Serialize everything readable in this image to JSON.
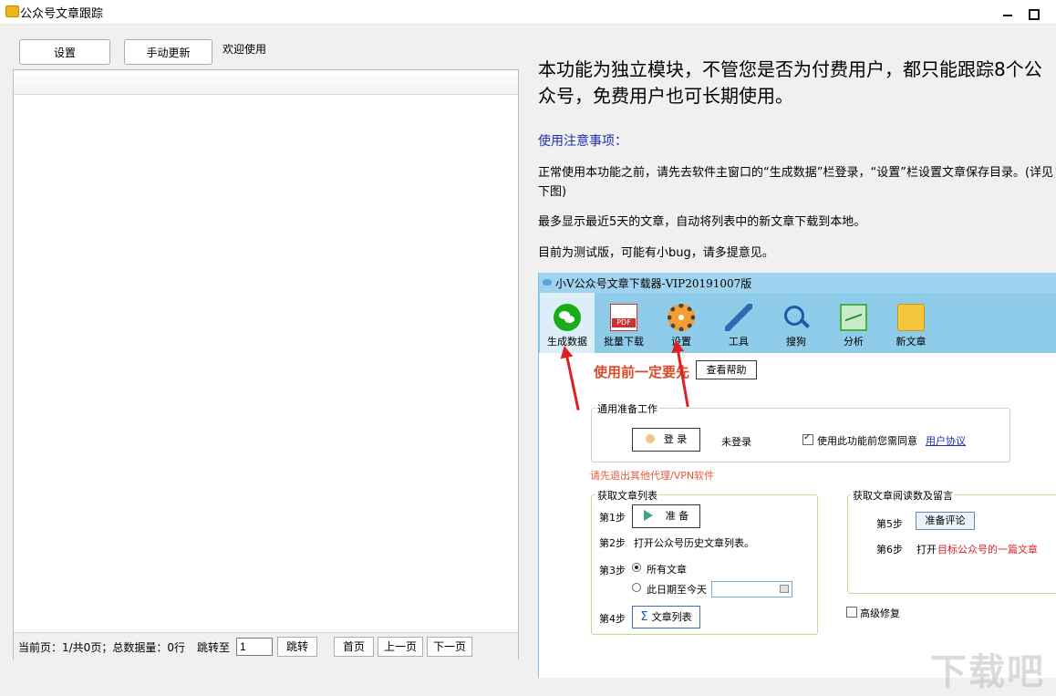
{
  "window": {
    "title": "公众号文章跟踪"
  },
  "toolbar": {
    "settings_label": "设置",
    "manual_update_label": "手动更新",
    "welcome_text": "欢迎使用"
  },
  "pager": {
    "status_text": "当前页：1/共0页；总数据量：0行",
    "jump_label": "跳转至",
    "page_input_value": "1",
    "jump_button": "跳转",
    "first_button": "首页",
    "prev_button": "上一页",
    "next_button": "下一页"
  },
  "info": {
    "headline": "本功能为独立模块，不管您是否为付费用户，都只能跟踪8个公众号，免费用户也可长期使用。",
    "notice_title": "使用注意事项：",
    "para1": "正常使用本功能之前，请先去软件主窗口的“生成数据”栏登录，“设置”栏设置文章保存目录。(详见下图)",
    "para2": "最多显示最近5天的文章，自动将列表中的新文章下载到本地。",
    "para3": "目前为测试版，可能有小bug，请多提意见。"
  },
  "screenshot": {
    "title": "小V公众号文章下载器-VIP20191007版",
    "tools": [
      {
        "label": "生成数据",
        "icon": "wechat-icon"
      },
      {
        "label": "批量下载",
        "icon": "pdf-icon"
      },
      {
        "label": "设置",
        "icon": "gear-icon"
      },
      {
        "label": "工具",
        "icon": "wrench-icon"
      },
      {
        "label": "搜狗",
        "icon": "search-icon"
      },
      {
        "label": "分析",
        "icon": "chart-icon"
      },
      {
        "label": "新文章",
        "icon": "book-icon"
      }
    ],
    "red_title": "使用前一定要先",
    "help_button": "查看帮助",
    "prep_group_title": "通用准备工作",
    "login_button": "登 录",
    "login_status": "未登录",
    "agree_text": "使用此功能前您需同意",
    "agreement_link": "用户协议",
    "proxy_note": "请先退出其他代理/VPN软件",
    "list_group_title": "获取文章列表",
    "step1": "第1步",
    "prepare_button": "准 备",
    "step2": "第2步",
    "step2_text": "打开公众号历史文章列表。",
    "step3": "第3步",
    "radio_all": "所有文章",
    "radio_date": "此日期至今天",
    "step4": "第4步",
    "article_list_button": "文章列表",
    "read_group_title": "获取文章阅读数及留言",
    "step5": "第5步",
    "prepare_comment_button": "准备评论",
    "step6": "第6步",
    "step6_prefix": "打开",
    "step6_target": "目标公众号的一篇文章",
    "advanced_fix": "高级修复"
  },
  "watermark": "下载吧",
  "colors": {
    "accent_red": "#d84a2a",
    "link_blue": "#1f2fb5",
    "toolbar_blue": "#8fccea"
  }
}
